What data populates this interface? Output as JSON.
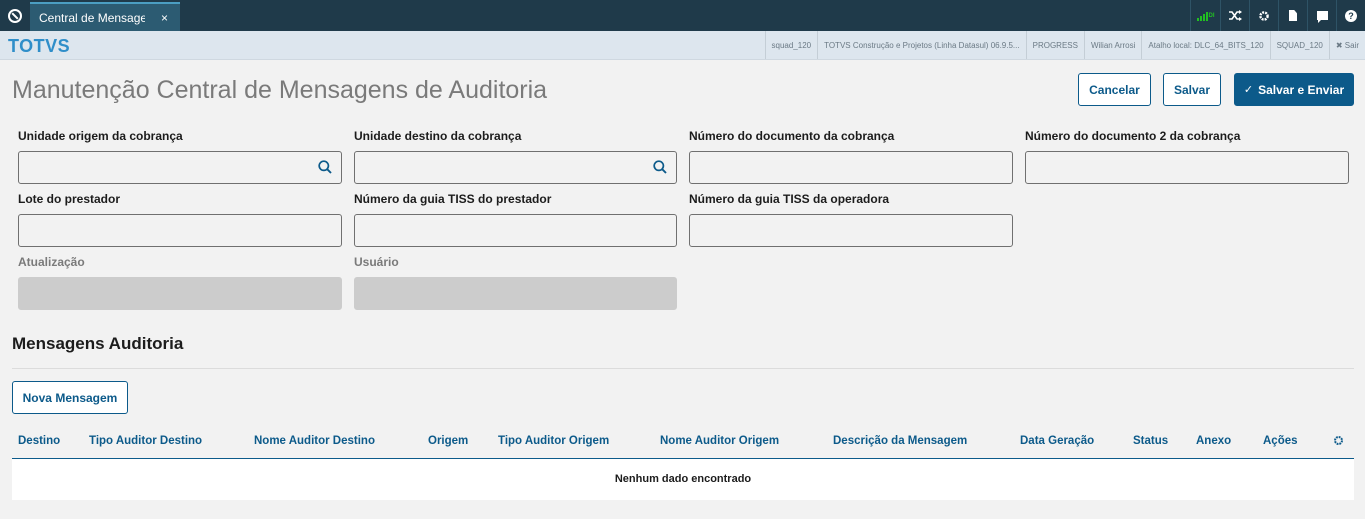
{
  "topbar": {
    "tab_label": "Central de Mensagens",
    "tab_close": "×",
    "signal_text": "DI"
  },
  "brand": "TOTVS",
  "status": {
    "items": [
      "squad_120",
      "TOTVS Construção e Projetos (Linha Datasul) 06.9.5...",
      "PROGRESS",
      "Wilian Arrosi",
      "Atalho local: DLC_64_BITS_120",
      "SQUAD_120"
    ],
    "logout": "✖ Sair"
  },
  "page": {
    "title": "Manutenção Central de Mensagens de Auditoria",
    "cancel": "Cancelar",
    "save": "Salvar",
    "save_send": "Salvar e Enviar"
  },
  "form": {
    "unidade_origem": "Unidade origem da cobrança",
    "unidade_destino": "Unidade destino da cobrança",
    "numero_documento": "Número do documento da cobrança",
    "numero_documento_2": "Número do documento 2 da cobrança",
    "lote_prestador": "Lote do prestador",
    "guia_tiss_prestador": "Número da guia TISS do prestador",
    "guia_tiss_operadora": "Número da guia TISS da operadora",
    "atualizacao": "Atualização",
    "usuario": "Usuário"
  },
  "section": {
    "title": "Mensagens Auditoria",
    "new_message": "Nova Mensagem"
  },
  "table": {
    "columns": [
      "Destino",
      "Tipo Auditor Destino",
      "Nome Auditor Destino",
      "Origem",
      "Tipo Auditor Origem",
      "Nome Auditor Origem",
      "Descrição da Mensagem",
      "Data Geração",
      "Status",
      "Anexo",
      "Ações"
    ],
    "empty": "Nenhum dado encontrado"
  },
  "colors": {
    "primary": "#0c5a8a",
    "topbar": "#1f3a4a",
    "brand": "#2f8ec9"
  }
}
